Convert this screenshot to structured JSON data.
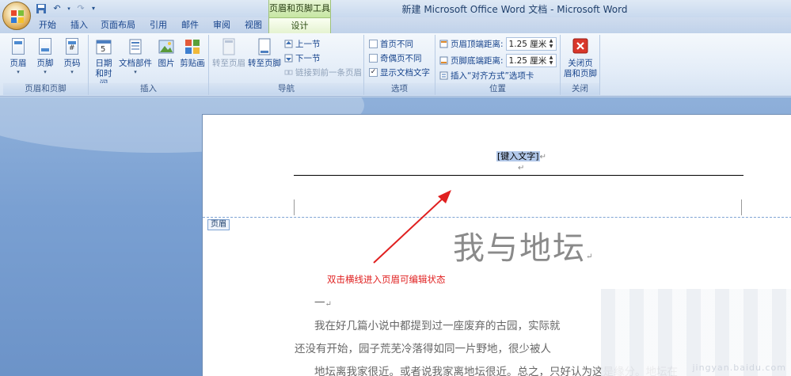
{
  "titlebar": {
    "window_title": "新建 Microsoft Office Word 文档 - Microsoft Word",
    "context_tools": "页眉和页脚工具",
    "qat": [
      "save-icon",
      "undo-icon",
      "redo-icon",
      "customize-icon"
    ]
  },
  "tabs": [
    "开始",
    "插入",
    "页面布局",
    "引用",
    "邮件",
    "审阅",
    "视图",
    "设计"
  ],
  "ribbon": {
    "group_header_footer": {
      "label": "页眉和页脚",
      "buttons": [
        "页眉",
        "页脚",
        "页码"
      ]
    },
    "group_insert": {
      "label": "插入",
      "datetime": [
        "日期",
        "和时间"
      ],
      "docparts": "文档部件",
      "picture": "图片",
      "clipart": "剪贴画"
    },
    "group_nav": {
      "label": "导航",
      "goto_header": "转至页眉",
      "goto_footer": "转至页脚",
      "prev": "上一节",
      "next": "下一节",
      "link_prev": "链接到前一条页眉"
    },
    "group_options": {
      "label": "选项",
      "first_page": "首页不同",
      "odd_even": "奇偶页不同",
      "show_text": "显示文档文字",
      "first_page_checked": false,
      "odd_even_checked": false,
      "show_text_checked": true
    },
    "group_position": {
      "label": "位置",
      "header_top_label": "页眉顶端距离:",
      "header_top_value": "1.25 厘米",
      "footer_bottom_label": "页脚底端距离:",
      "footer_bottom_value": "1.25 厘米",
      "insert_align_tab": "插入“对齐方式”选项卡"
    },
    "group_close": {
      "label": "关闭",
      "close_btn": [
        "关闭页",
        "眉和页脚"
      ]
    }
  },
  "document": {
    "header_placeholder": "[键入文字]",
    "header_tag": "页眉",
    "title": "我与地坛",
    "annotation": "双击横线进入页眉可编辑状态",
    "section_mark": "一",
    "lines": [
      "我在好几篇小说中都提到过一座废弃的古园，实际就",
      "还没有开始，园子荒芜冷落得如同一片野地，很少被人",
      "地坛离我家很近。或者说我家离地坛很近。总之，只好认为这是缘分。地坛在"
    ],
    "watermark": "jingyan.baidu.com"
  },
  "colors": {
    "accent": "#15428b",
    "context_green": "#c6e6a2",
    "annotation_red": "#e02020"
  }
}
